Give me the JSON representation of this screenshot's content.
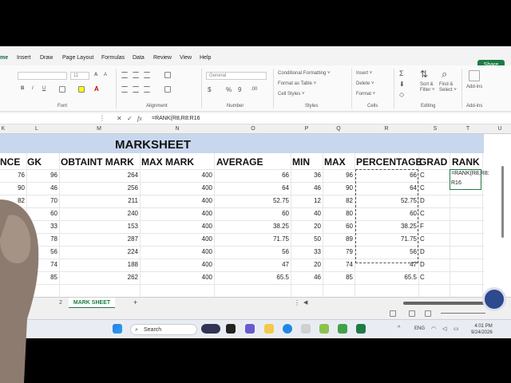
{
  "ribbon_tabs": [
    "me",
    "Insert",
    "Draw",
    "Page Layout",
    "Formulas",
    "Data",
    "Review",
    "View",
    "Help"
  ],
  "share_label": "Share",
  "ribbon": {
    "font_label": "Font",
    "alignment_label": "Alignment",
    "number_label": "Number",
    "number_format": "General",
    "styles_label": "Styles",
    "conditional_formatting": "Conditional Formatting",
    "format_as_table": "Format as Table",
    "cell_styles": "Cell Styles",
    "cells_label": "Cells",
    "insert": "Insert",
    "delete": "Delete",
    "format": "Format",
    "editing_label": "Editing",
    "sort_filter": "Sort &",
    "filter": "Filter",
    "find_select": "Find &",
    "select": "Select",
    "addins_label": "Add-ins",
    "addins": "Add-ins"
  },
  "formula_bar": {
    "formula": "=RANK(R8,R8:R16"
  },
  "column_letters": [
    "K",
    "L",
    "M",
    "N",
    "O",
    "P",
    "Q",
    "R",
    "S",
    "T",
    "U"
  ],
  "sheet": {
    "title": "MARKSHEET",
    "headers": [
      "NCE",
      "GK",
      "OBTAINT MARK",
      "MAX MARK",
      "AVERAGE",
      "MIN",
      "MAX",
      "PERCENTAGE",
      "GRAD",
      "RANK"
    ],
    "rows": [
      [
        "76",
        "96",
        "264",
        "400",
        "66",
        "36",
        "96",
        "66",
        "C"
      ],
      [
        "90",
        "46",
        "256",
        "400",
        "64",
        "46",
        "90",
        "64",
        "C"
      ],
      [
        "82",
        "70",
        "211",
        "400",
        "52.75",
        "12",
        "82",
        "52.75",
        "D"
      ],
      [
        "",
        "60",
        "240",
        "400",
        "60",
        "40",
        "80",
        "60",
        "C"
      ],
      [
        "",
        "33",
        "153",
        "400",
        "38.25",
        "20",
        "60",
        "38.25",
        "F"
      ],
      [
        "",
        "78",
        "287",
        "400",
        "71.75",
        "50",
        "89",
        "71.75",
        "C"
      ],
      [
        "",
        "56",
        "224",
        "400",
        "56",
        "33",
        "79",
        "56",
        "D"
      ],
      [
        "",
        "74",
        "188",
        "400",
        "47",
        "20",
        "74",
        "47",
        "D"
      ],
      [
        "",
        "85",
        "262",
        "400",
        "65.5",
        "46",
        "85",
        "65.5",
        "C"
      ]
    ],
    "rank_edit_line1": "=RANK(R8,R8:",
    "rank_edit_line2": "R16"
  },
  "sheet_tabs": {
    "prev": "2",
    "active": "MARK SHEET",
    "add": "+"
  },
  "taskbar": {
    "search_label": "Search",
    "lang": "ENG",
    "time": "4:01 PM",
    "date": "9/24/2026"
  }
}
